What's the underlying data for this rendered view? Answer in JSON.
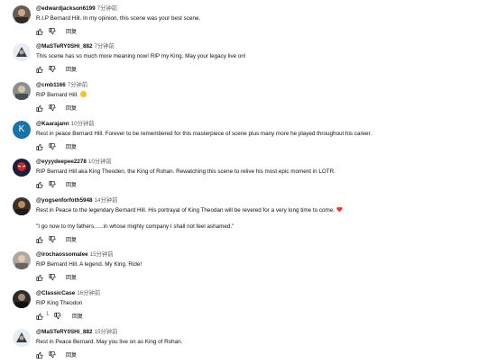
{
  "comments": [
    {
      "handle": "@edwardjackson6199",
      "time": "7分钟前",
      "lines": [
        "R.I.P Bernard Hill. In my opinion, this scene was your best scene."
      ],
      "likes": "",
      "reply": "回复"
    },
    {
      "handle": "@MaSTeRY0SHi_882",
      "time": "7分钟前",
      "lines": [
        "This scene has so much more meaning now! RIP my King. May your legacy live on!"
      ],
      "likes": "",
      "reply": "回复"
    },
    {
      "handle": "@cmb1166",
      "time": "7分钟前",
      "lines": [
        "RIP Bernard Hill."
      ],
      "likes": "",
      "reply": "回复"
    },
    {
      "handle": "@Kaarajann",
      "time": "10分钟前",
      "lines": [
        "Rest in peace Bernard Hill. Forever to be remembered for this masterpiece of scene plus many more he played throughout his career."
      ],
      "likes": "",
      "reply": "回复",
      "avatar_letter": "K"
    },
    {
      "handle": "@eyyydeepee2278",
      "time": "10分钟前",
      "lines": [
        "RIP Bernard Hill aka King Theoden, the King of Rohan. Rewatching this scene to relive his most epic moment in LOTR."
      ],
      "likes": "",
      "reply": "回复"
    },
    {
      "handle": "@yogsenforfoth5948",
      "time": "14分钟前",
      "lines": [
        "Rest in Peace to the legendary Bernard Hill. His portrayal of King Theodan will be revered for a very long time to come.",
        "",
        "\"I go now to my fathers......in whose mighty company I shall not feel ashamed.\""
      ],
      "likes": "",
      "reply": "回复"
    },
    {
      "handle": "@irochaossomalee",
      "time": "15分钟前",
      "lines": [
        "RIP Bernard Hill. A legend. My King. Ride!"
      ],
      "likes": "",
      "reply": "回复"
    },
    {
      "handle": "@ClassicCase",
      "time": "16分钟前",
      "lines": [
        "RIP King Theodon"
      ],
      "likes": "1",
      "reply": "回复"
    },
    {
      "handle": "@MaSTeRY0SHi_882",
      "time": "15分钟前",
      "lines": [
        "Rest in Peace Bernard. May you live on as King of Rohan."
      ],
      "likes": "",
      "reply": "回复"
    }
  ],
  "colors": {
    "text": "#0f0f0f",
    "secondary": "#606060",
    "heart": "#e53935",
    "avatar_k": "#1a73a8"
  },
  "icons": [
    "thumb-up-icon",
    "thumb-down-icon",
    "heart-icon",
    "smile-emoji-icon"
  ]
}
